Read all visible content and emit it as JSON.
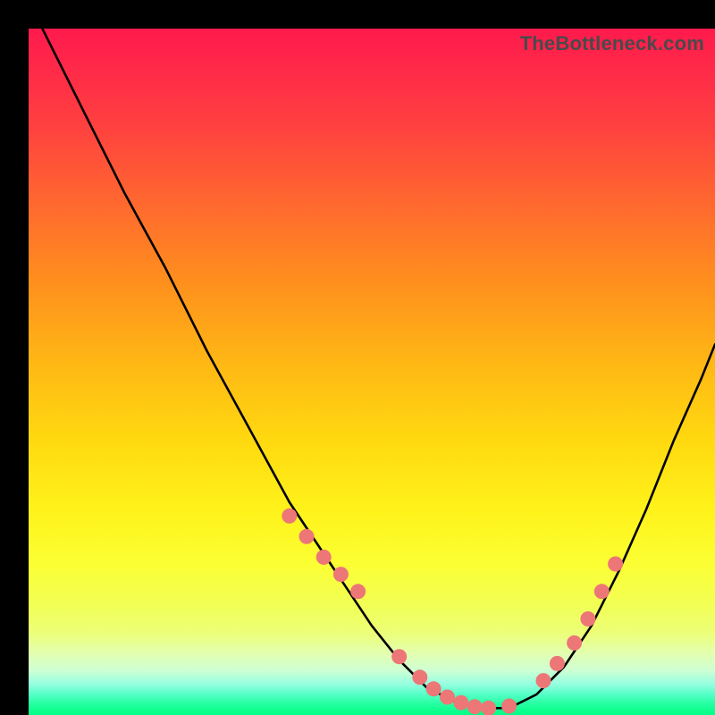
{
  "watermark": "TheBottleneck.com",
  "chart_data": {
    "type": "line",
    "title": "",
    "xlabel": "",
    "ylabel": "",
    "xlim": [
      0,
      100
    ],
    "ylim": [
      0,
      100
    ],
    "series": [
      {
        "name": "bottleneck-curve",
        "x": [
          2,
          8,
          14,
          20,
          26,
          32,
          38,
          44,
          50,
          54,
          58,
          62,
          66,
          70,
          74,
          78,
          82,
          86,
          90,
          94,
          98,
          100
        ],
        "y": [
          100,
          88,
          76,
          65,
          53,
          42,
          31,
          22,
          13,
          8,
          4,
          2,
          1,
          1,
          3,
          7,
          13,
          21,
          30,
          40,
          49,
          54
        ]
      }
    ],
    "markers": {
      "name": "highlight-dots",
      "color": "#ed7676",
      "x": [
        38,
        40.5,
        43,
        45.5,
        48,
        54,
        57,
        59,
        61,
        63,
        65,
        67,
        70,
        75,
        77,
        79.5,
        81.5,
        83.5,
        85.5
      ],
      "y": [
        29,
        26,
        23,
        20.5,
        18,
        8.5,
        5.5,
        3.8,
        2.6,
        1.8,
        1.2,
        1,
        1.3,
        5,
        7.5,
        10.5,
        14,
        18,
        22
      ]
    }
  }
}
